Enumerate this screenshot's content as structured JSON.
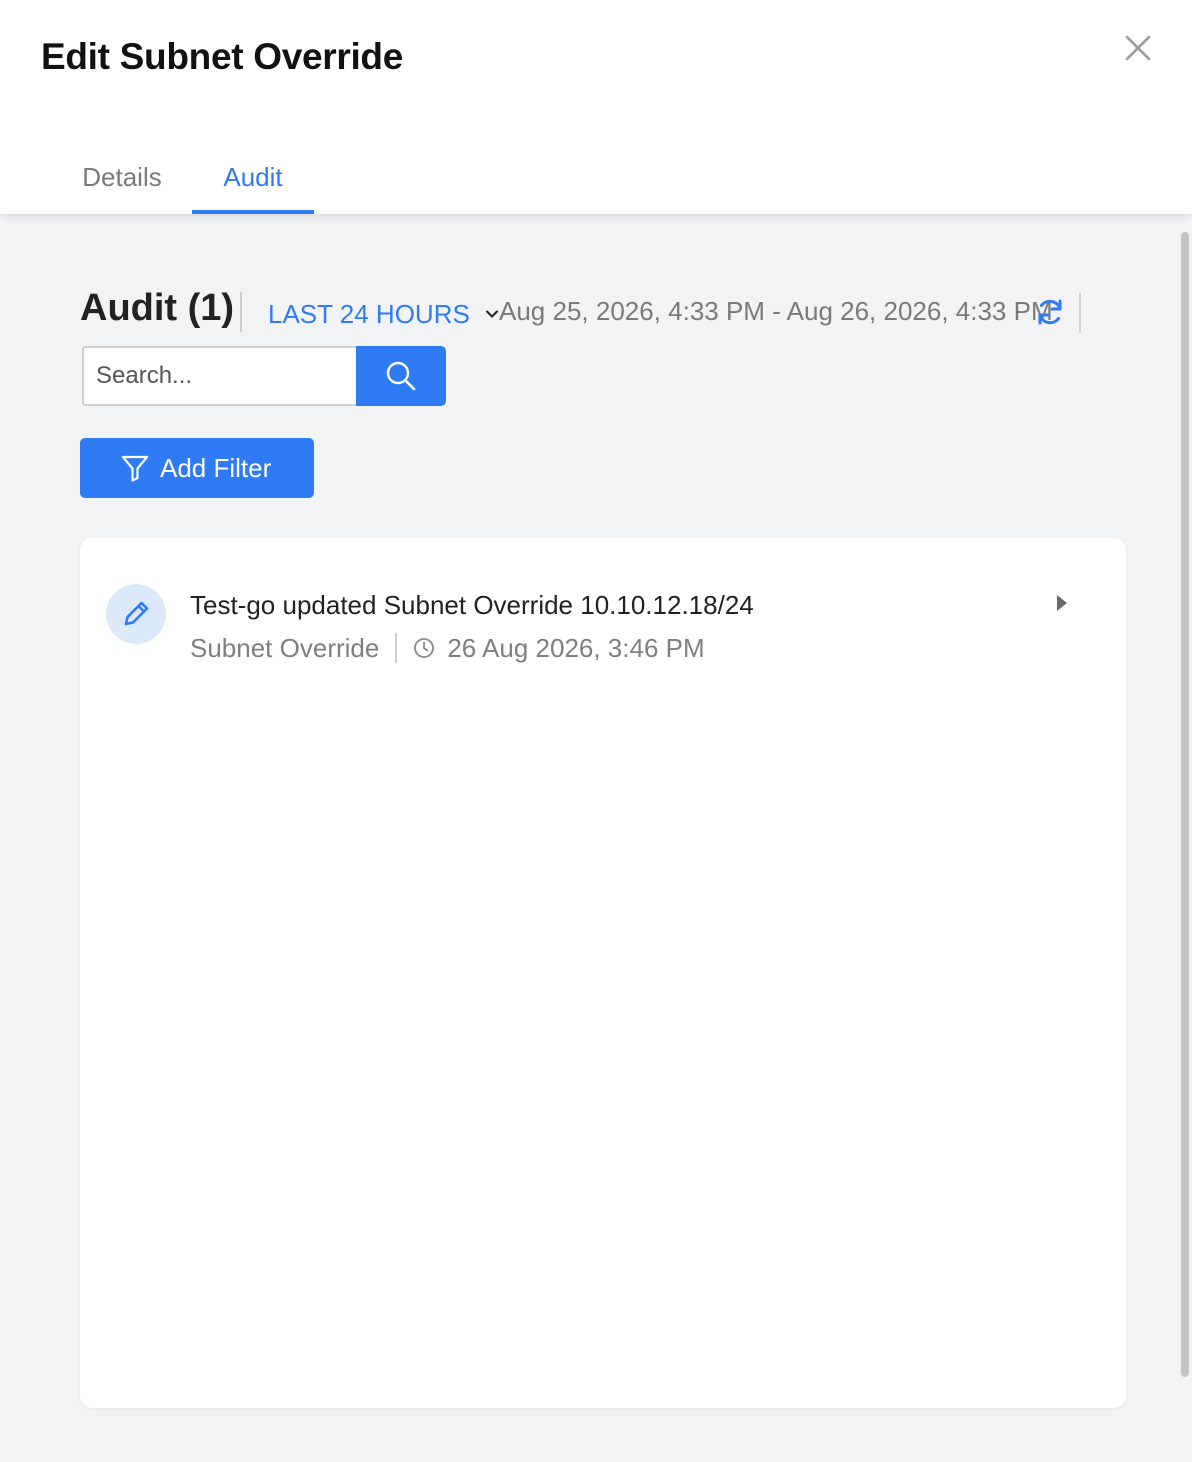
{
  "dialog": {
    "title": "Edit Subnet Override",
    "close_icon": "close-icon"
  },
  "tabs": [
    {
      "label": "Details",
      "active": false
    },
    {
      "label": "Audit",
      "active": true
    }
  ],
  "audit": {
    "heading": "Audit (1)",
    "range_label": "LAST 24 HOURS",
    "date_range": "Aug 25, 2026, 4:33 PM - Aug 26, 2026, 4:33 PM",
    "refresh_icon": "refresh-icon",
    "search": {
      "placeholder": "Search...",
      "value": "",
      "button_icon": "search-icon"
    },
    "add_filter_label": "Add Filter",
    "entries": [
      {
        "icon": "pencil-icon",
        "title": "Test-go updated Subnet Override 10.10.12.18/24",
        "type": "Subnet Override",
        "timestamp": "26 Aug 2026, 3:46 PM"
      }
    ]
  },
  "colors": {
    "accent": "#2f7bf5",
    "background": "#f2f3f5",
    "muted_text": "#7a7a7a",
    "avatar_bg": "#dce9fb"
  }
}
